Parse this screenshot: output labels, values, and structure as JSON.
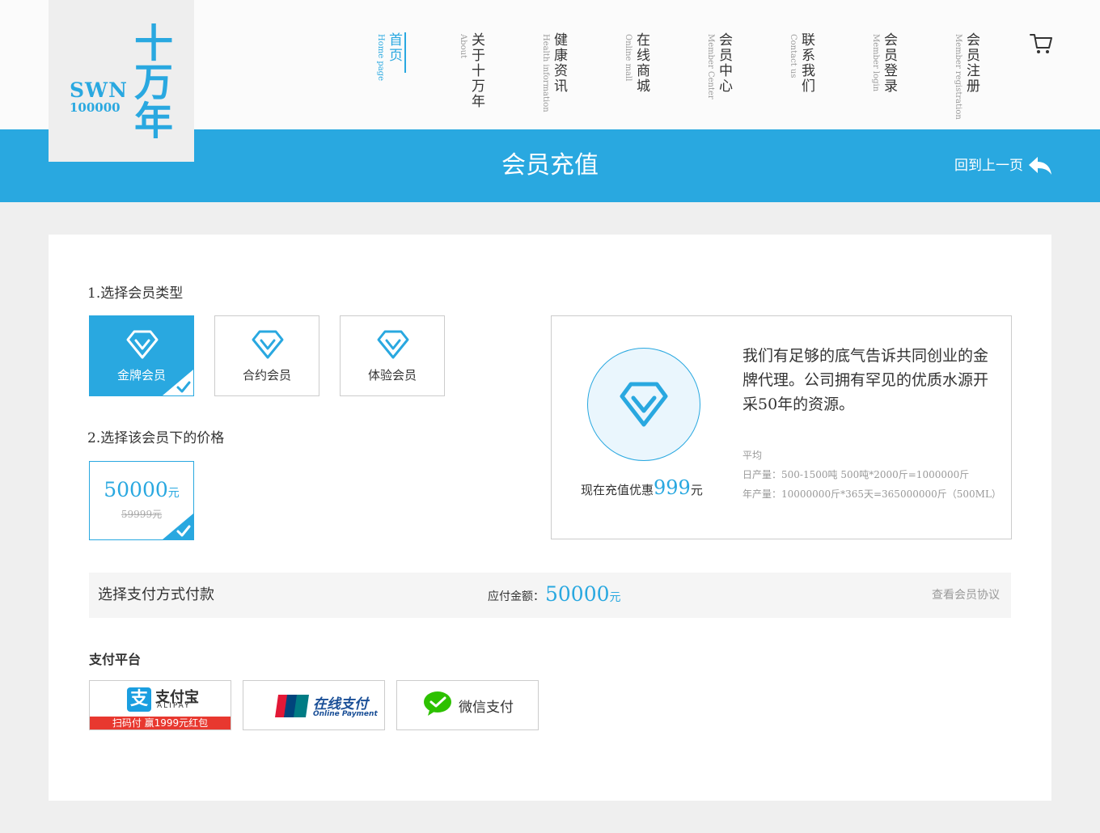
{
  "logo": {
    "latin_top": "SWN",
    "latin_bottom": "100000",
    "cjk": [
      "十",
      "万",
      "年"
    ]
  },
  "nav": [
    {
      "zh": "首页",
      "en": "Home page",
      "active": true
    },
    {
      "zh": "关于十万年",
      "en": "About",
      "active": false
    },
    {
      "zh": "健康资讯",
      "en": "Health information",
      "active": false
    },
    {
      "zh": "在线商城",
      "en": "Online mall",
      "active": false
    },
    {
      "zh": "会员中心",
      "en": "Member Center",
      "active": false
    },
    {
      "zh": "联系我们",
      "en": "Contact us",
      "active": false
    },
    {
      "zh": "会员登录",
      "en": "Member login",
      "active": false
    },
    {
      "zh": "会员注册",
      "en": "Member registration",
      "active": false
    }
  ],
  "icons": {
    "cart": "cart-icon",
    "back": "back-arrow-icon",
    "diamond": "diamond-icon",
    "check": "checkmark-icon"
  },
  "band": {
    "title": "会员充值",
    "back_label": "回到上一页"
  },
  "step1": {
    "label": "1.选择会员类型"
  },
  "member_types": [
    {
      "label": "金牌会员",
      "selected": true
    },
    {
      "label": "合约会员",
      "selected": false
    },
    {
      "label": "体验会员",
      "selected": false
    }
  ],
  "step2": {
    "label": "2.选择该会员下的价格"
  },
  "price_option": {
    "price": "50000",
    "unit": "元",
    "old": "59999元"
  },
  "info": {
    "promo_prefix": "现在充值优惠",
    "promo_value": "999",
    "promo_unit": "元",
    "description": "我们有足够的底气告诉共同创业的金牌代理。公司拥有罕见的优质水源开采50年的资源。",
    "stats_title": "平均",
    "daily": "日产量：500-1500吨   500吨*2000斤=1000000斤",
    "yearly": "年产量：10000000斤*365天=365000000斤（500ML）"
  },
  "payment_bar": {
    "title": "选择支付方式付款",
    "amount_label": "应付金额：",
    "amount": "50000",
    "amount_unit": "元",
    "agreement": "查看会员协议"
  },
  "platform": {
    "label": "支付平台",
    "alipay": {
      "icon_char": "支",
      "name": "支付宝",
      "en": "ALIPAY",
      "promo": "扫码付 赢1999元红包"
    },
    "unionpay": {
      "name": "在线支付",
      "en": "Online Payment"
    },
    "wechat": {
      "name": "微信支付"
    }
  },
  "colors": {
    "accent": "#29a8e0",
    "alipay_red": "#e8382f",
    "wechat_green": "#2dc100",
    "unionpay_blue": "#1a4f97"
  }
}
